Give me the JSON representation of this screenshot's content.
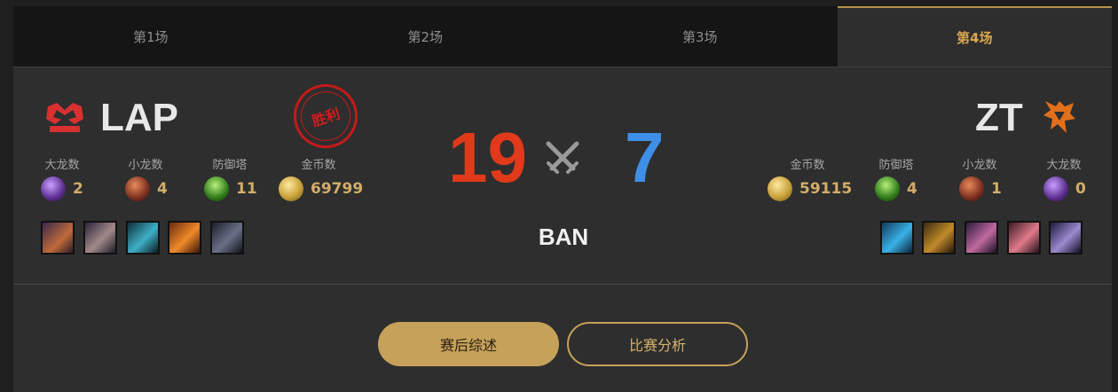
{
  "tabs": [
    {
      "label": "第1场",
      "active": false
    },
    {
      "label": "第2场",
      "active": false
    },
    {
      "label": "第3场",
      "active": false
    },
    {
      "label": "第4场",
      "active": true
    }
  ],
  "left_team": {
    "name": "LAP",
    "result_stamp": "胜利",
    "stats": [
      {
        "label": "大龙数",
        "value": "2",
        "icon": "baron-icon"
      },
      {
        "label": "小龙数",
        "value": "4",
        "icon": "drake-icon"
      },
      {
        "label": "防御塔",
        "value": "11",
        "icon": "tower-icon"
      },
      {
        "label": "金币数",
        "value": "69799",
        "icon": "gold-icon"
      }
    ],
    "bans": [
      "champion-1",
      "champion-2",
      "champion-3",
      "champion-4",
      "champion-5"
    ]
  },
  "right_team": {
    "name": "ZT",
    "stats": [
      {
        "label": "金币数",
        "value": "59115",
        "icon": "gold-icon"
      },
      {
        "label": "防御塔",
        "value": "4",
        "icon": "tower-icon"
      },
      {
        "label": "小龙数",
        "value": "1",
        "icon": "drake-icon"
      },
      {
        "label": "大龙数",
        "value": "0",
        "icon": "baron-icon"
      }
    ],
    "bans": [
      "champion-1",
      "champion-2",
      "champion-3",
      "champion-4",
      "champion-5"
    ]
  },
  "score": {
    "left": "19",
    "right": "7"
  },
  "ban_label": "BAN",
  "buttons": {
    "summary": "赛后综述",
    "analysis": "比赛分析"
  },
  "colors": {
    "accent": "#c6a15a",
    "left_score": "#e03a1a",
    "right_score": "#3f8fe6",
    "stamp": "#c41a1a"
  }
}
